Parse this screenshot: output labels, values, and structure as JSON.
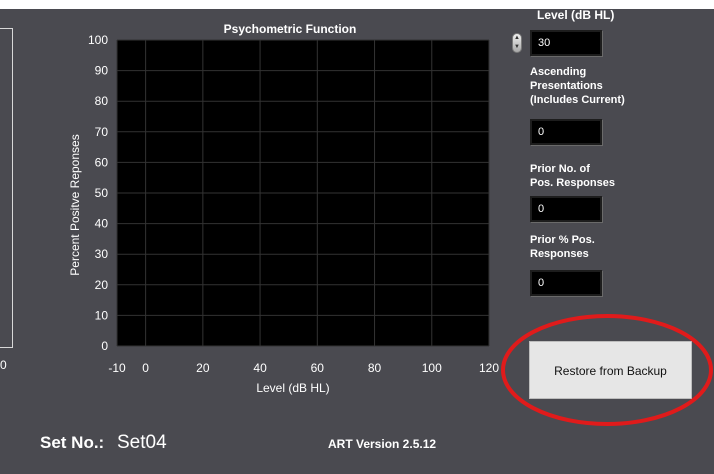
{
  "chart": {
    "title": "Psychometric Function",
    "ylabel": "Percent  Positve Reponses",
    "xlabel": "Level (dB HL)",
    "y_ticks": [
      "100",
      "90",
      "80",
      "70",
      "60",
      "50",
      "40",
      "30",
      "20",
      "10",
      "0"
    ],
    "x_ticks": [
      "-10",
      "0",
      "20",
      "40",
      "60",
      "80",
      "100",
      "120"
    ],
    "left_axis_tick": "0"
  },
  "chart_data": {
    "type": "line",
    "title": "Psychometric Function",
    "xlabel": "Level (dB HL)",
    "ylabel": "Percent  Positve Reponses",
    "xlim": [
      -10,
      120
    ],
    "ylim": [
      0,
      100
    ],
    "x_ticks": [
      -10,
      0,
      20,
      40,
      60,
      80,
      100,
      120
    ],
    "y_ticks": [
      0,
      10,
      20,
      30,
      40,
      50,
      60,
      70,
      80,
      90,
      100
    ],
    "grid": true,
    "background": "#000000",
    "grid_color": "#333333",
    "series": []
  },
  "fields": {
    "level": {
      "label": "Level (dB HL)",
      "value": "30"
    },
    "ascending": {
      "label_lines": [
        "Ascending",
        "Presentations",
        "(Includes Current)"
      ],
      "value": "0"
    },
    "prior_pos": {
      "label_lines": [
        "Prior No. of",
        "Pos. Responses"
      ],
      "value": "0"
    },
    "prior_pct": {
      "label_lines": [
        "Prior % Pos.",
        "Responses"
      ],
      "value": "0"
    }
  },
  "restore_button": {
    "label": "Restore from Backup"
  },
  "footer": {
    "set_label": "Set No.:",
    "set_value": "Set04",
    "version": "ART Version 2.5.12"
  },
  "icons": {
    "spinner": "updown-spinner-icon",
    "annotation": "red-circle-annotation"
  },
  "colors": {
    "background": "#4a4a50",
    "plot_background": "#000000",
    "annotation": "#e01b1b",
    "button": "#e6e6e6"
  }
}
